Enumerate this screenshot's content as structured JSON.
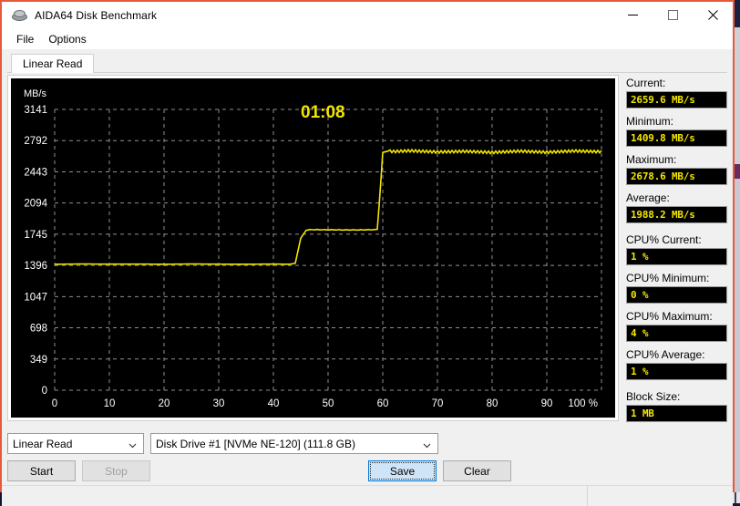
{
  "window": {
    "title": "AIDA64 Disk Benchmark",
    "icon": "disk-drive-icon",
    "accent_border": "#e8593c",
    "controls": {
      "minimize": "minimize-icon",
      "maximize": "maximize-icon",
      "close": "close-icon"
    }
  },
  "menu": {
    "items": [
      {
        "label": "File"
      },
      {
        "label": "Options"
      }
    ]
  },
  "tabs": [
    {
      "label": "Linear Read",
      "active": true
    }
  ],
  "chart_data": {
    "type": "line",
    "title": "",
    "xlabel": "",
    "ylabel": "MB/s",
    "y_unit_label": "MB/s",
    "x_unit_label": "%",
    "xlim": [
      0,
      100
    ],
    "ylim": [
      0,
      3141
    ],
    "yticks": [
      0,
      349,
      698,
      1047,
      1396,
      1745,
      2094,
      2443,
      2792,
      3141
    ],
    "ytick_labels": [
      "0",
      "349",
      "698",
      "1047",
      "1396",
      "1745",
      "2094",
      "2443",
      "2792",
      "3141"
    ],
    "xticks": [
      0,
      10,
      20,
      30,
      40,
      50,
      60,
      70,
      80,
      90,
      100
    ],
    "xtick_labels": [
      "0",
      "10",
      "20",
      "30",
      "40",
      "50",
      "60",
      "70",
      "80",
      "90",
      "100 %"
    ],
    "grid": true,
    "grid_style": "dashed",
    "grid_color": "#909090",
    "background": "#000000",
    "line_color": "#f2e500",
    "legend": "none",
    "annotations": [
      {
        "name": "elapsed-timer",
        "text": "01:08",
        "x": 45,
        "y": 3050,
        "color": "#f2e500"
      }
    ],
    "series": [
      {
        "name": "Linear Read",
        "x": [
          0,
          5,
          10,
          15,
          20,
          25,
          30,
          35,
          40,
          43,
          44,
          45,
          46,
          47,
          50,
          55,
          58,
          59,
          59.5,
          60,
          61,
          62,
          65,
          70,
          75,
          80,
          85,
          90,
          95,
          100
        ],
        "values": [
          1409,
          1412,
          1410,
          1411,
          1409,
          1412,
          1410,
          1409,
          1411,
          1409,
          1420,
          1700,
          1790,
          1795,
          1793,
          1791,
          1794,
          1800,
          2200,
          2660,
          2675,
          2670,
          2678,
          2665,
          2672,
          2660,
          2674,
          2662,
          2676,
          2668
        ]
      }
    ]
  },
  "stats": [
    {
      "name": "current",
      "label": "Current:",
      "value": "2659.6 MB/s"
    },
    {
      "name": "minimum",
      "label": "Minimum:",
      "value": "1409.8 MB/s"
    },
    {
      "name": "maximum",
      "label": "Maximum:",
      "value": "2678.6 MB/s"
    },
    {
      "name": "average",
      "label": "Average:",
      "value": "1988.2 MB/s"
    },
    {
      "name": "cpu-current",
      "label": "CPU% Current:",
      "value": "1 %"
    },
    {
      "name": "cpu-minimum",
      "label": "CPU% Minimum:",
      "value": "0 %"
    },
    {
      "name": "cpu-maximum",
      "label": "CPU% Maximum:",
      "value": "4 %"
    },
    {
      "name": "cpu-average",
      "label": "CPU% Average:",
      "value": "1 %"
    },
    {
      "name": "block-size",
      "label": "Block Size:",
      "value": "1 MB"
    }
  ],
  "controls": {
    "test_mode": {
      "value": "Linear Read"
    },
    "disk_drive": {
      "value": "Disk Drive #1  [NVMe   NE-120]  (111.8 GB)"
    },
    "start_label": "Start",
    "stop_label": "Stop",
    "save_label": "Save",
    "clear_label": "Clear"
  },
  "status_bar": {
    "left": "",
    "right": ""
  }
}
